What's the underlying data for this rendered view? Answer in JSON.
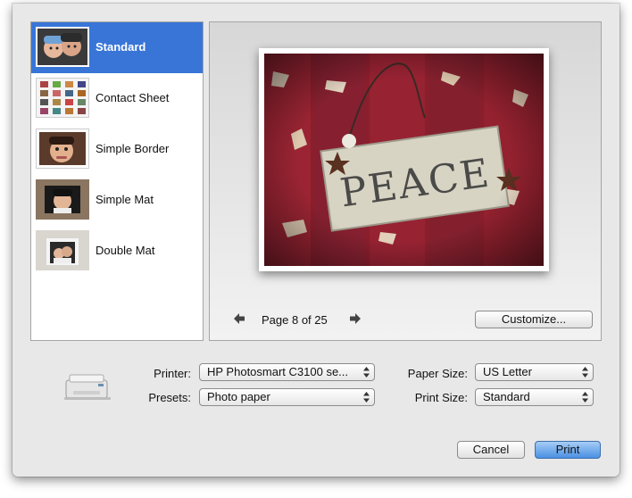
{
  "layouts": [
    {
      "label": "Standard",
      "selected": true
    },
    {
      "label": "Contact Sheet",
      "selected": false
    },
    {
      "label": "Simple Border",
      "selected": false
    },
    {
      "label": "Simple Mat",
      "selected": false
    },
    {
      "label": "Double Mat",
      "selected": false
    }
  ],
  "preview": {
    "page_label": "Page 8 of 25",
    "customize_label": "Customize..."
  },
  "options": {
    "printer_label": "Printer:",
    "printer_value": "HP Photosmart C3100 se...",
    "presets_label": "Presets:",
    "presets_value": "Photo paper",
    "paper_size_label": "Paper Size:",
    "paper_size_value": "US Letter",
    "print_size_label": "Print Size:",
    "print_size_value": "Standard"
  },
  "buttons": {
    "cancel": "Cancel",
    "print": "Print"
  },
  "colors": {
    "selection": "#3875d7",
    "photo_background": "#8b1e2b",
    "sign": "#d8d4c4"
  },
  "icons": {
    "prev": "left-arrow-icon",
    "next": "right-arrow-icon",
    "printer": "printer-icon"
  }
}
